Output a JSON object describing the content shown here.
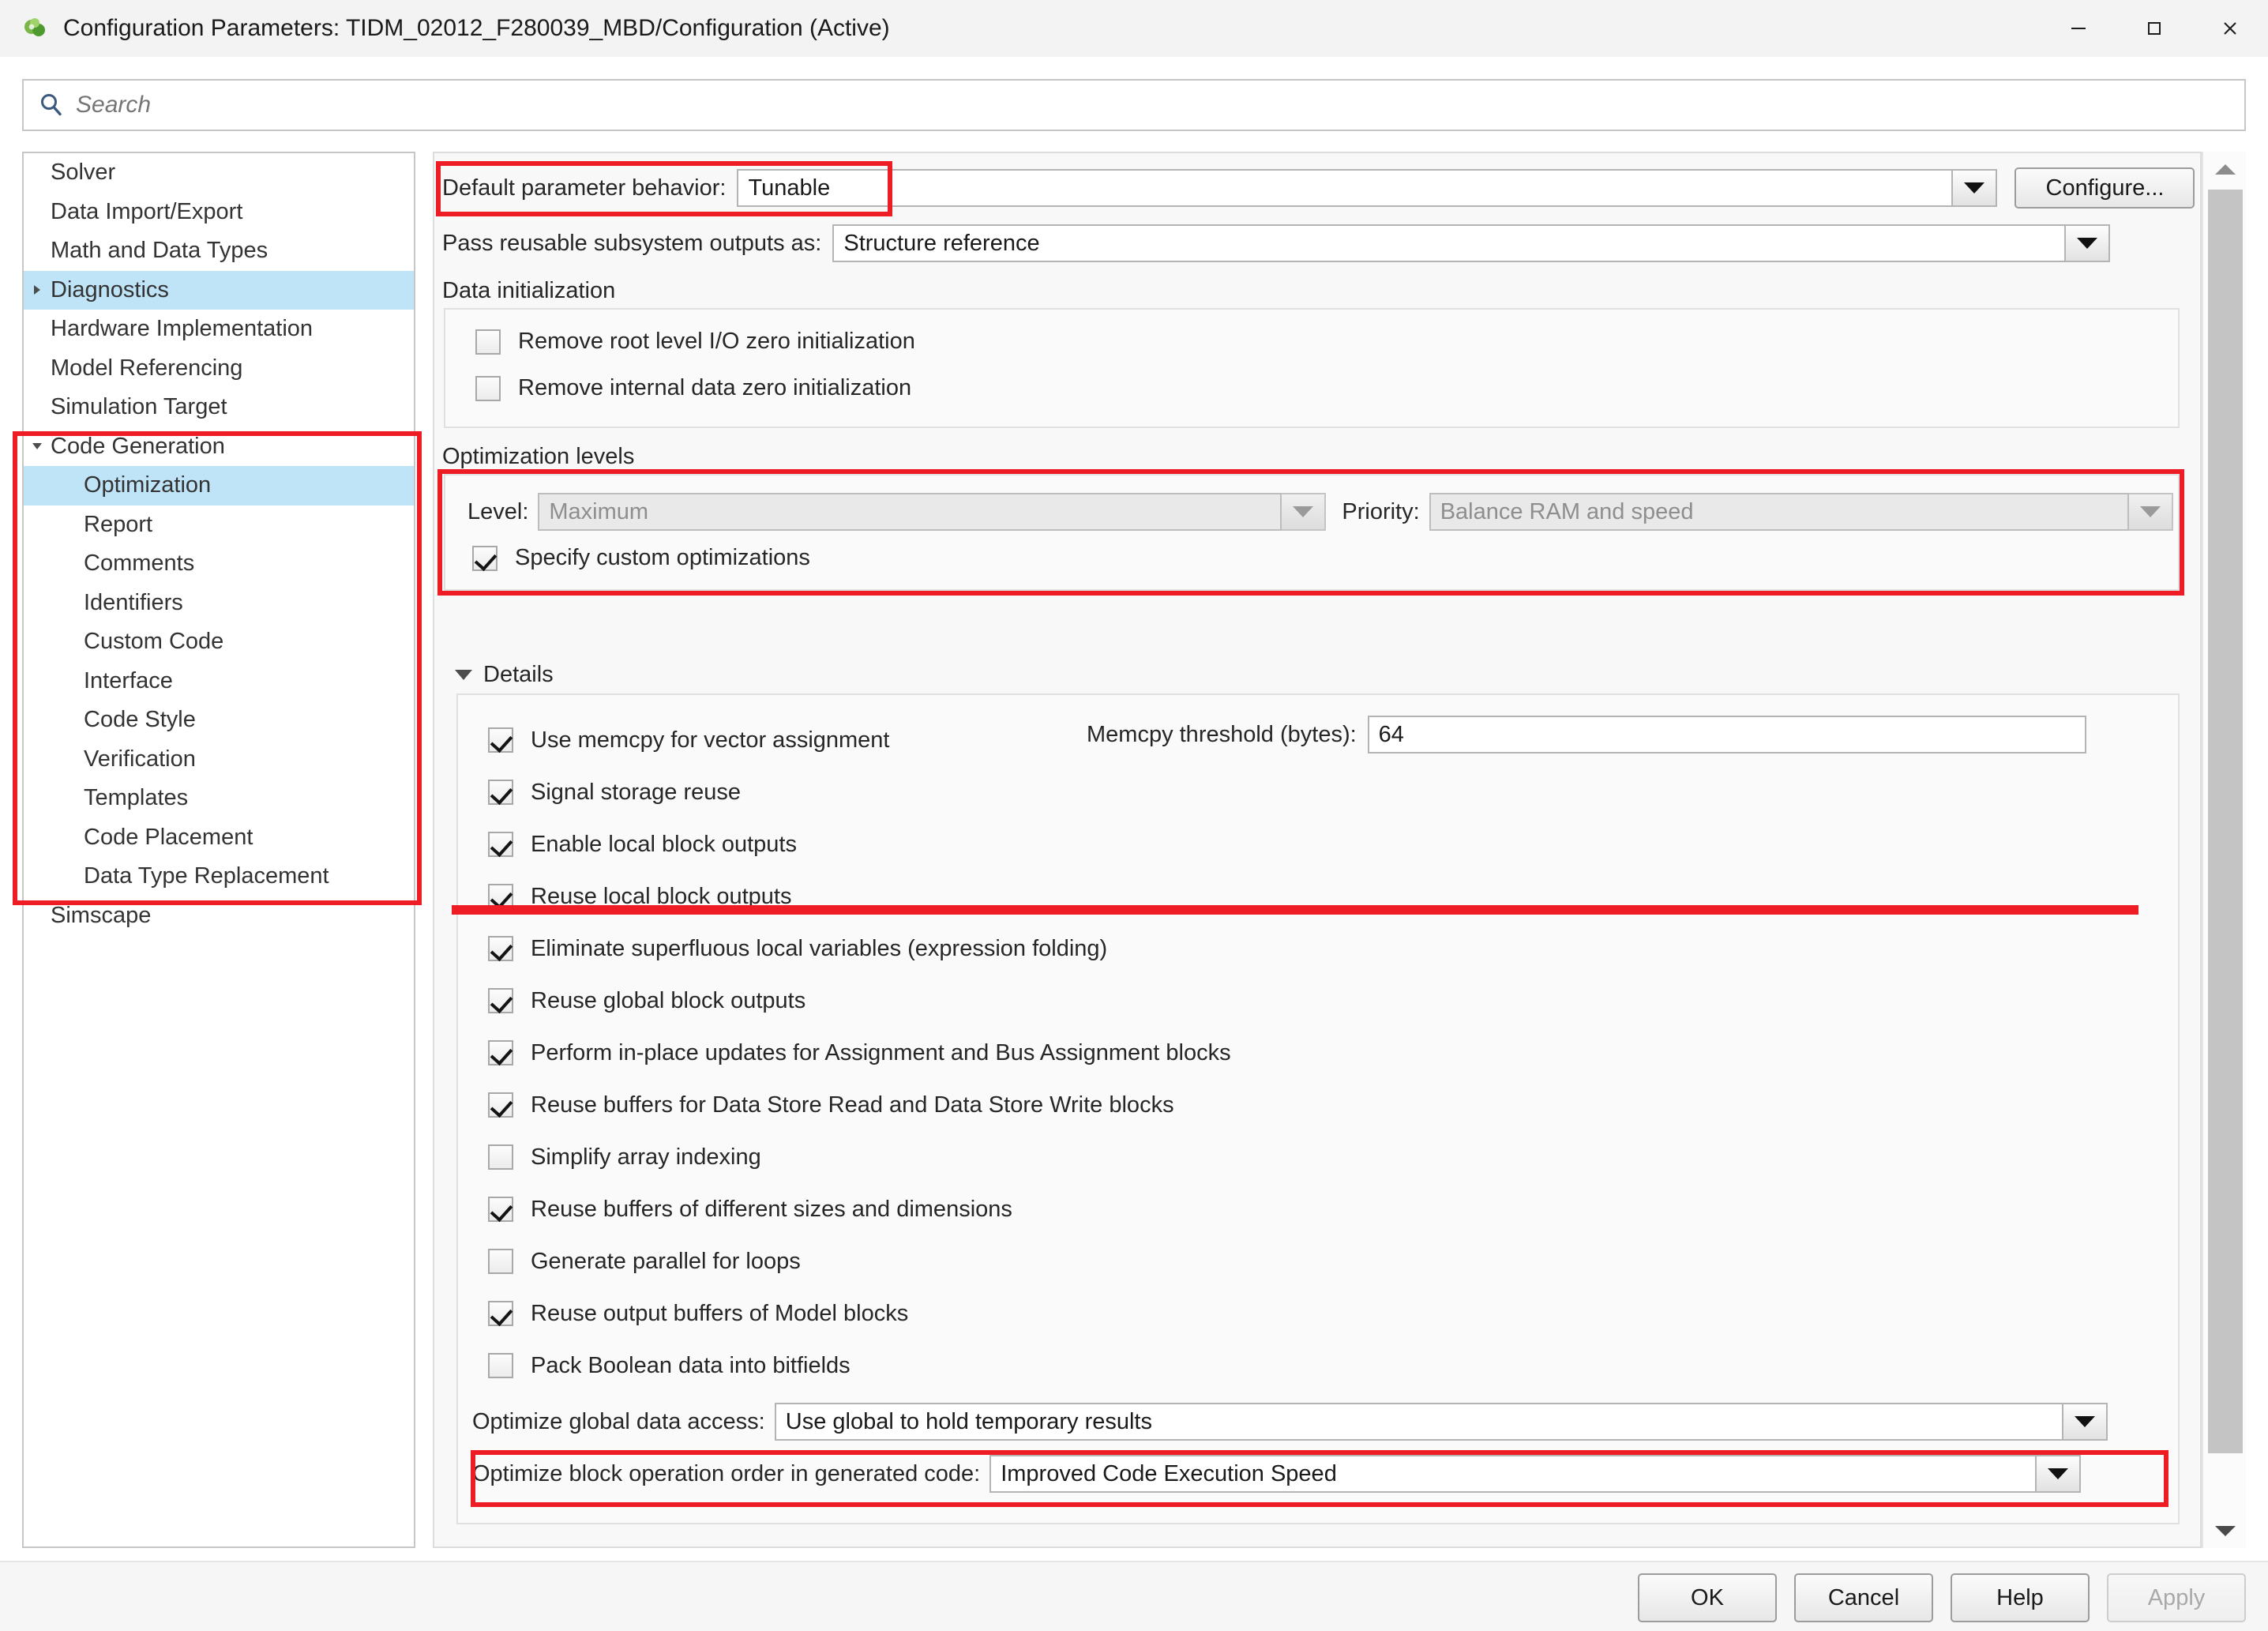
{
  "window": {
    "title": "Configuration Parameters: TIDM_02012_F280039_MBD/Configuration (Active)",
    "app_icon": "simulink-icon",
    "minimize_label": "—",
    "maximize_label": "□",
    "close_label": "✕"
  },
  "search": {
    "placeholder": "Search",
    "value": "",
    "icon": "search-icon"
  },
  "tree": {
    "items": [
      {
        "label": "Solver",
        "level": 0,
        "arrow": "",
        "selected": false
      },
      {
        "label": "Data Import/Export",
        "level": 0,
        "arrow": "",
        "selected": false
      },
      {
        "label": "Math and Data Types",
        "level": 0,
        "arrow": "",
        "selected": false
      },
      {
        "label": "Diagnostics",
        "level": 0,
        "arrow": "right",
        "selected": true
      },
      {
        "label": "Hardware Implementation",
        "level": 0,
        "arrow": "",
        "selected": false
      },
      {
        "label": "Model Referencing",
        "level": 0,
        "arrow": "",
        "selected": false
      },
      {
        "label": "Simulation Target",
        "level": 0,
        "arrow": "",
        "selected": false
      },
      {
        "label": "Code Generation",
        "level": 0,
        "arrow": "down",
        "selected": false
      },
      {
        "label": "Optimization",
        "level": 1,
        "arrow": "",
        "selected": true
      },
      {
        "label": "Report",
        "level": 1,
        "arrow": "",
        "selected": false
      },
      {
        "label": "Comments",
        "level": 1,
        "arrow": "",
        "selected": false
      },
      {
        "label": "Identifiers",
        "level": 1,
        "arrow": "",
        "selected": false
      },
      {
        "label": "Custom Code",
        "level": 1,
        "arrow": "",
        "selected": false
      },
      {
        "label": "Interface",
        "level": 1,
        "arrow": "",
        "selected": false
      },
      {
        "label": "Code Style",
        "level": 1,
        "arrow": "",
        "selected": false
      },
      {
        "label": "Verification",
        "level": 1,
        "arrow": "",
        "selected": false
      },
      {
        "label": "Templates",
        "level": 1,
        "arrow": "",
        "selected": false
      },
      {
        "label": "Code Placement",
        "level": 1,
        "arrow": "",
        "selected": false
      },
      {
        "label": "Data Type Replacement",
        "level": 1,
        "arrow": "",
        "selected": false
      },
      {
        "label": "Simscape",
        "level": 0,
        "arrow": "",
        "selected": false
      }
    ]
  },
  "main": {
    "default_parameter_behavior": {
      "label": "Default parameter behavior:",
      "value": "Tunable"
    },
    "configure_button": "Configure...",
    "pass_reusable": {
      "label": "Pass reusable subsystem outputs as:",
      "value": "Structure reference"
    },
    "data_initialization": {
      "group_label": "Data initialization",
      "checkboxes": [
        {
          "label": "Remove root level I/O zero initialization",
          "checked": false
        },
        {
          "label": "Remove internal data zero initialization",
          "checked": false
        }
      ]
    },
    "optimization_levels": {
      "group_label": "Optimization levels",
      "level_label": "Level:",
      "level_value": "Maximum",
      "priority_label": "Priority:",
      "priority_value": "Balance RAM and speed",
      "specify_custom": {
        "label": "Specify custom optimizations",
        "checked": true
      }
    },
    "details": {
      "header": "Details",
      "checkboxes": [
        {
          "label": "Use memcpy for vector assignment",
          "checked": true
        },
        {
          "label": "Signal storage reuse",
          "checked": true
        },
        {
          "label": "Enable local block outputs",
          "checked": true
        },
        {
          "label": "Reuse local block outputs",
          "checked": true
        },
        {
          "label": "Eliminate superfluous local variables (expression folding)",
          "checked": true
        },
        {
          "label": "Reuse global block outputs",
          "checked": true
        },
        {
          "label": "Perform in-place updates for Assignment and Bus Assignment blocks",
          "checked": true
        },
        {
          "label": "Reuse buffers for Data Store Read and Data Store Write blocks",
          "checked": true
        },
        {
          "label": "Simplify array indexing",
          "checked": false
        },
        {
          "label": "Reuse buffers of different sizes and dimensions",
          "checked": true
        },
        {
          "label": "Generate parallel for loops",
          "checked": false
        },
        {
          "label": "Reuse output buffers of Model blocks",
          "checked": true
        },
        {
          "label": "Pack Boolean data into bitfields",
          "checked": false
        }
      ],
      "memcpy_threshold": {
        "label": "Memcpy threshold (bytes):",
        "value": "64"
      },
      "optimize_global_data_access": {
        "label": "Optimize global data access:",
        "value": "Use global to hold temporary results"
      },
      "optimize_block_order": {
        "label": "Optimize block operation order in generated code:",
        "value": "Improved Code Execution Speed"
      }
    }
  },
  "footer": {
    "ok": "OK",
    "cancel": "Cancel",
    "help": "Help",
    "apply": "Apply"
  },
  "colors": {
    "highlight_red": "#ee1c25",
    "selection_blue": "#bfe3f7",
    "panel_bg": "#f8f8f8"
  }
}
